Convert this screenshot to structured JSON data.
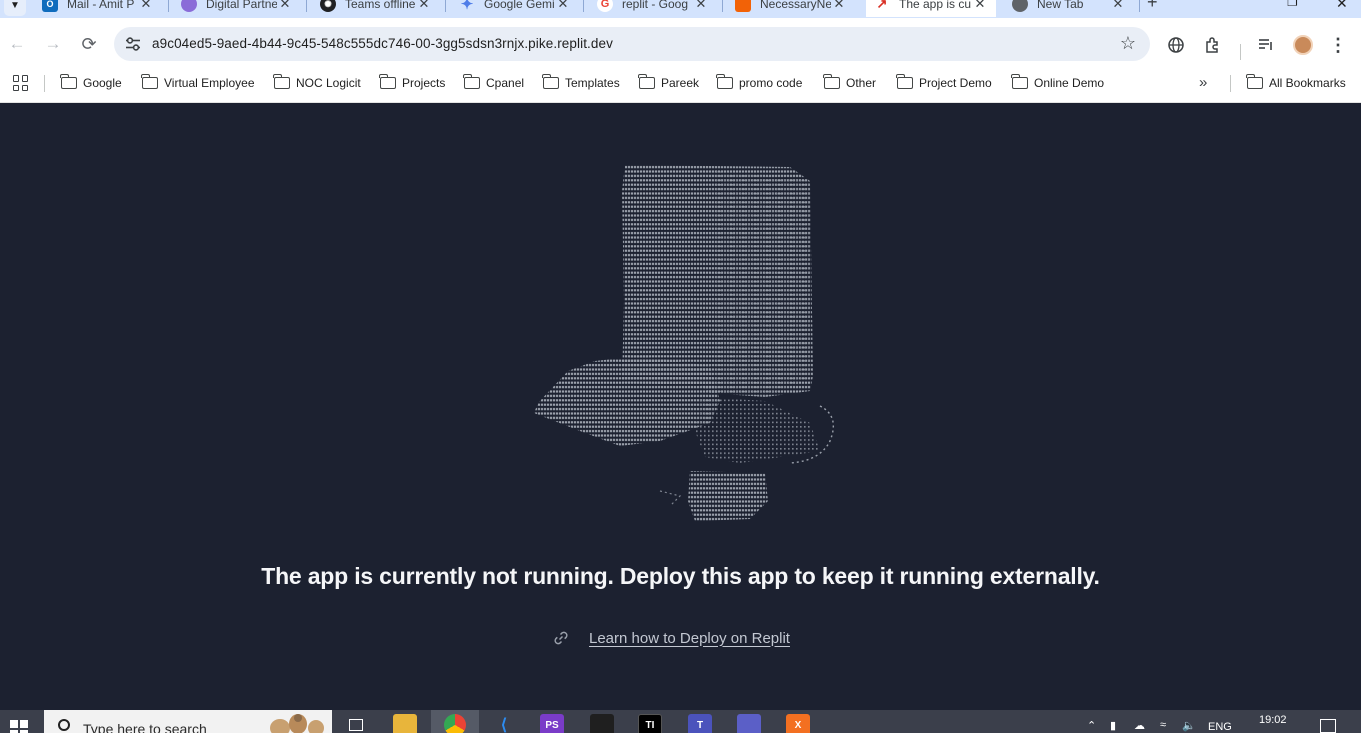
{
  "browser": {
    "tabs": [
      {
        "title": "Mail - Amit P",
        "favicon": "outlook-icon",
        "color": "#0f6cbd",
        "active": false
      },
      {
        "title": "Digital Partne",
        "favicon": "copilot-icon",
        "color": "#8a6cd8",
        "active": false
      },
      {
        "title": "Teams offline",
        "favicon": "openai-icon",
        "color": "#202124",
        "active": false
      },
      {
        "title": "Google Gemi",
        "favicon": "gemini-icon",
        "color": "#4f7de8",
        "active": false
      },
      {
        "title": "replit - Goog",
        "favicon": "google-icon",
        "color": "#ea4335",
        "active": false
      },
      {
        "title": "NecessaryNe",
        "favicon": "replit-icon",
        "color": "#f26207",
        "active": false
      },
      {
        "title": "The app is cu",
        "favicon": "chart-icon",
        "color": "#d93025",
        "active": true
      },
      {
        "title": "New Tab",
        "favicon": "chrome-icon",
        "color": "#5f6368",
        "active": false
      }
    ],
    "url": "a9c04ed5-9aed-4b44-9c45-548c555dc746-00-3gg5sdsn3rnjx.pike.replit.dev",
    "bookmarks": [
      "Google",
      "Virtual Employee",
      "NOC Logicit",
      "Projects",
      "Cpanel",
      "Templates",
      "Pareek",
      "promo code",
      "Other",
      "Project Demo",
      "Online Demo"
    ],
    "all_bookmarks_label": "All Bookmarks"
  },
  "page": {
    "message": "The app is currently not running. Deploy this app to keep it running externally.",
    "link_text": "Learn how to Deploy on Replit",
    "background_color": "#1c2130",
    "ascii_color": "#9aa0ab"
  },
  "taskbar": {
    "search_placeholder": "Type here to search",
    "language": "ENG",
    "time": "19:02"
  }
}
